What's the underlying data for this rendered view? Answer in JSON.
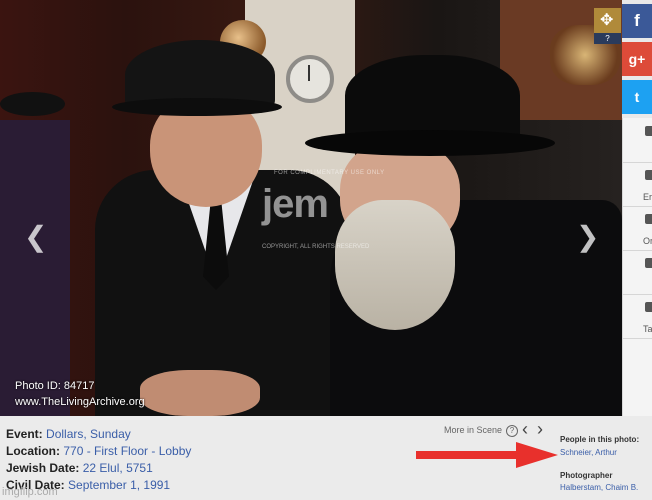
{
  "photo": {
    "watermark_top": "FOR COMPLIMENTARY USE ONLY",
    "watermark_logo": "jem",
    "watermark_bottom": "COPYRIGHT, ALL RIGHTS RESERVED",
    "photo_id": "Photo ID: 84717",
    "site": "www.TheLivingArchive.org"
  },
  "icons": {
    "move": "✥",
    "help": "?",
    "prev": "❮",
    "next": "❯"
  },
  "social": {
    "facebook": "f",
    "google_plus": "g+",
    "twitter": "t"
  },
  "side_panel": {
    "items": [
      "",
      "Er",
      "Orde",
      "",
      "Tag"
    ]
  },
  "info": {
    "event_label": "Event:",
    "event_value": "Dollars, Sunday",
    "location_label": "Location:",
    "location_value": "770 - First Floor - Lobby",
    "jewish_date_label": "Jewish Date:",
    "jewish_date_value": "22 Elul, 5751",
    "civil_date_label": "Civil Date:",
    "civil_date_value": "September 1, 1991",
    "more_in_scene": "More in Scene",
    "people_label": "People in this photo:",
    "people_value": "Schneier, Arthur",
    "photographer_label": "Photographer",
    "photographer_value": "Halberstam, Chaim B.",
    "imgflip": "imgflip.com"
  },
  "colors": {
    "link": "#3a5ea8",
    "arrow": "#e8302c"
  }
}
